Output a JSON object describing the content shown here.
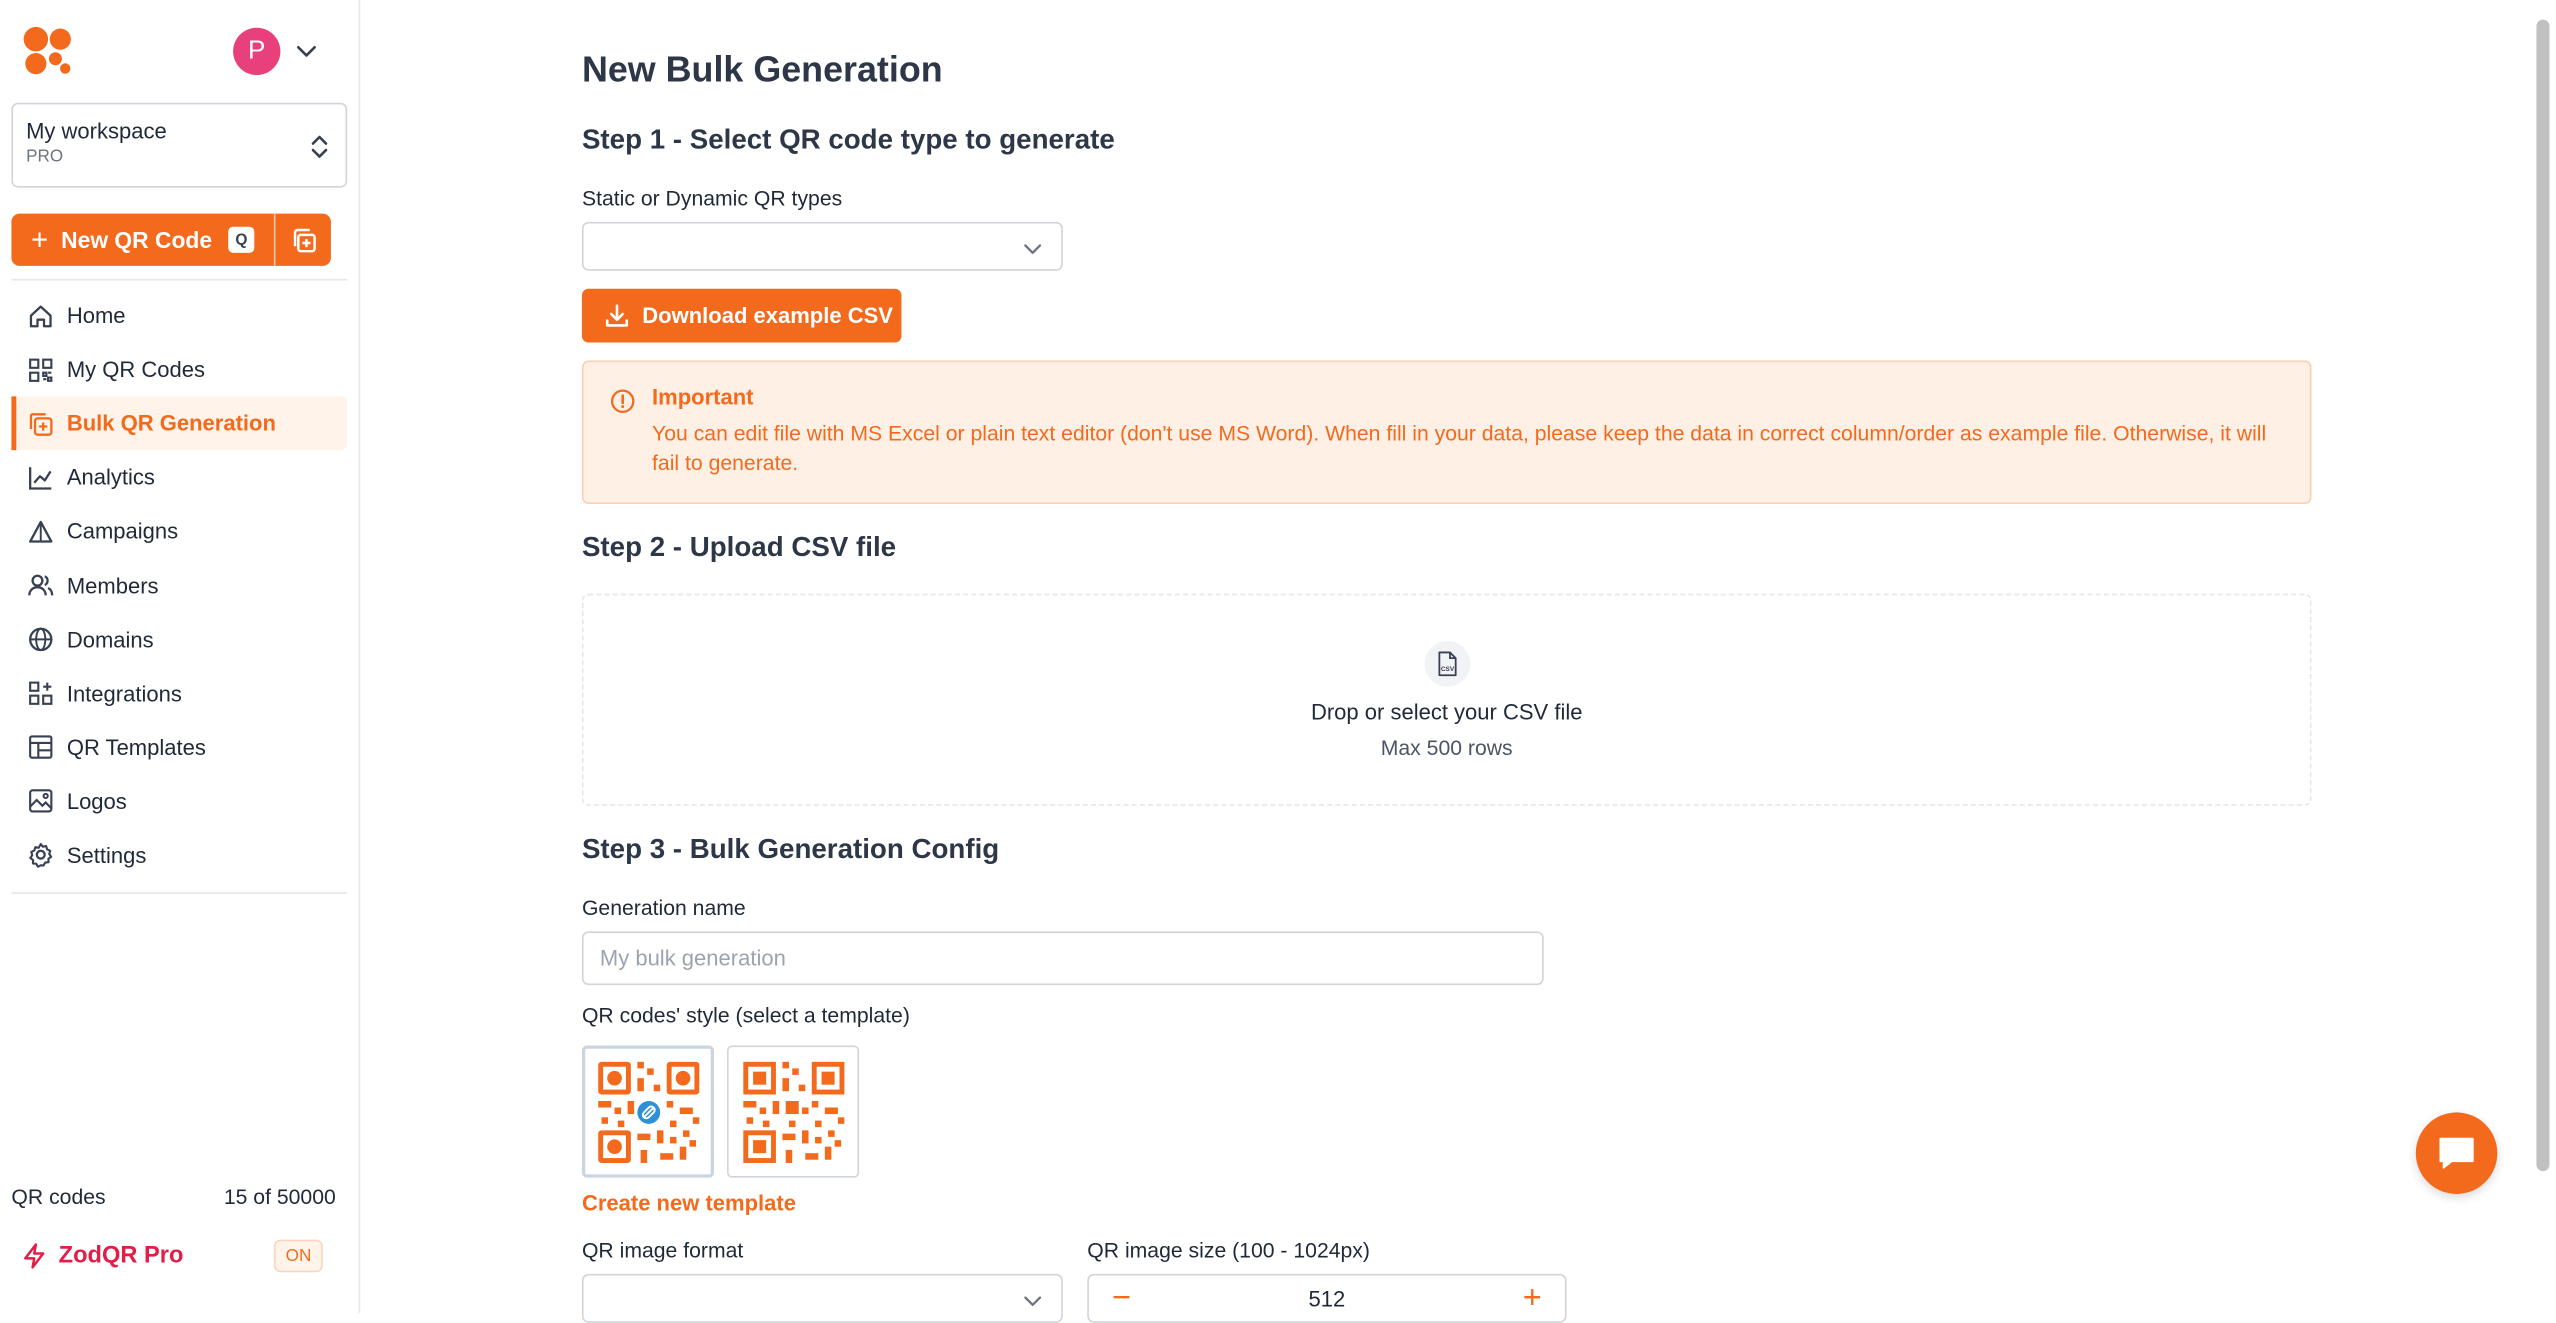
{
  "sidebar": {
    "avatar_initial": "P",
    "workspace": {
      "name": "My workspace",
      "plan": "PRO"
    },
    "new_qr": {
      "label": "New QR Code",
      "shortcut": "Q"
    },
    "nav": [
      {
        "label": "Home",
        "icon": "home-icon"
      },
      {
        "label": "My QR Codes",
        "icon": "qr-grid-icon"
      },
      {
        "label": "Bulk QR Generation",
        "icon": "bulk-copy-icon",
        "active": true
      },
      {
        "label": "Analytics",
        "icon": "analytics-icon"
      },
      {
        "label": "Campaigns",
        "icon": "campaigns-icon"
      },
      {
        "label": "Members",
        "icon": "members-icon"
      },
      {
        "label": "Domains",
        "icon": "globe-icon"
      },
      {
        "label": "Integrations",
        "icon": "integrations-icon"
      },
      {
        "label": "QR Templates",
        "icon": "templates-icon"
      },
      {
        "label": "Logos",
        "icon": "image-icon"
      },
      {
        "label": "Settings",
        "icon": "gear-icon"
      }
    ],
    "qr_codes": {
      "label": "QR codes",
      "count": "15 of 50000"
    },
    "pro": {
      "label": "ZodQR Pro",
      "status": "ON"
    }
  },
  "main": {
    "title": "New Bulk Generation",
    "step1": {
      "title": "Step 1 - Select QR code type to generate",
      "type_label": "Static or Dynamic QR types",
      "type_value": "",
      "download_label": "Download example CSV",
      "alert_title": "Important",
      "alert_body": "You can edit file with MS Excel or plain text editor (don't use MS Word). When fill in your data, please keep the data in correct column/order as example file. Otherwise, it will fail to generate."
    },
    "step2": {
      "title": "Step 2 - Upload CSV file",
      "drop_label": "Drop or select your CSV file",
      "max_rows": "Max 500 rows"
    },
    "step3": {
      "title": "Step 3 - Bulk Generation Config",
      "name_label": "Generation name",
      "name_placeholder": "My bulk generation",
      "name_value": "",
      "style_label": "QR codes' style (select a template)",
      "create_template": "Create new template",
      "format_label": "QR image format",
      "format_value": "",
      "size_label": "QR image size (100 - 1024px)",
      "size_value": "512"
    }
  },
  "colors": {
    "accent": "#f36a1d",
    "alert_bg": "#fff0e6",
    "pro": "#e11d48",
    "avatar": "#e8407a"
  }
}
